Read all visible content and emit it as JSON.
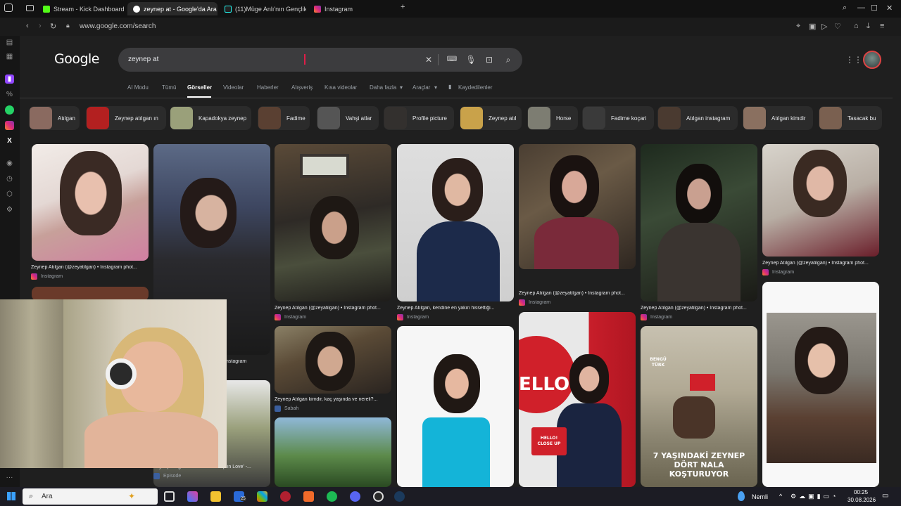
{
  "browser": {
    "tabs": [
      {
        "label": "Stream - Kick Dashboard",
        "color": "#53fc18"
      },
      {
        "label": "zeynep at - Google'da Ara",
        "color": "#ffffff",
        "active": true
      },
      {
        "label": "(11)Müge Anlı'nın Gençlik H",
        "color": "#25f4ee"
      },
      {
        "label": "Instagram",
        "color": "#dd2a7b"
      }
    ],
    "new_tab": "+",
    "url": "www.google.com/search"
  },
  "google": {
    "logo": "Google",
    "query": "zeynep at",
    "nav_tabs": [
      "AI Modu",
      "Tümü",
      "Görseller",
      "Videolar",
      "Haberler",
      "Alışveriş",
      "Kısa videolar",
      "Daha fazla",
      "Araçlar",
      "Kaydedilenler"
    ],
    "active_tab": "Görseller",
    "chips": [
      {
        "label": "Atılgan",
        "color": "#8a6a60"
      },
      {
        "label": "Zeynep atılgan ın",
        "color": "#b32020"
      },
      {
        "label": "Kapadokya zeynep",
        "color": "#9aa07a"
      },
      {
        "label": "Fadime",
        "color": "#5a4032"
      },
      {
        "label": "Vahşi atlar",
        "color": "#555555"
      },
      {
        "label": "Profile picture",
        "color": "#33302e"
      },
      {
        "label": "Zeynep atıl",
        "color": "#c9a24a"
      },
      {
        "label": "Horse",
        "color": "#7d7d72"
      },
      {
        "label": "Fadime koçari",
        "color": "#3a3a3a"
      },
      {
        "label": "Atılgan instagram",
        "color": "#4a3a30"
      },
      {
        "label": "Atılgan kimdir",
        "color": "#8a7060"
      },
      {
        "label": "Tasacak bu",
        "color": "#7a6050"
      }
    ],
    "results": [
      {
        "caption": "Zeynep Atılgan (@zeyatilgan) • Instagram phot...",
        "source": "Instagram"
      },
      {
        "caption": "Zeynep Atılgan (@zeyatilgan) • Instagram phot...",
        "source": "Instagram"
      },
      {
        "caption": "Zeynep Atılgan, kendine en yakın hissettiği...",
        "source": "Instagram"
      },
      {
        "caption": "Zeynep Atılgan (@zeyatilgan) • Instagram phot...",
        "source": "Instagram"
      },
      {
        "caption": "Zeynep Atılgan (@zeyatilgan) • Instagram phot...",
        "source": "Instagram"
      },
      {
        "caption": "Zeynep Atılgan (@zeyatilgan) • Instagram phot...",
        "source": "Instagram"
      },
      {
        "caption": "Zeynep Atılgan kimdir, kaç yaşında ve nereli?...",
        "source": "Sabah"
      },
      {
        "caption": "Zeynep Atılgan talks About 'Deep in Love' -...",
        "source": "Episode"
      },
      {
        "caption": "",
        "source": "Instagram"
      }
    ],
    "overlay_texts": {
      "hello": "ELLO!",
      "hello_box": "HELLO! CLOSE UP",
      "news_headline": "7 YAŞINDAKİ ZEYNEP DÖRT NALA KOŞTURUYOR",
      "news_brand": "BENGÜ TÜRK"
    }
  },
  "taskbar": {
    "search_label": "Ara",
    "weather": "Nemli",
    "time": "00:25",
    "date": "30.08.2026",
    "badge": "25"
  }
}
